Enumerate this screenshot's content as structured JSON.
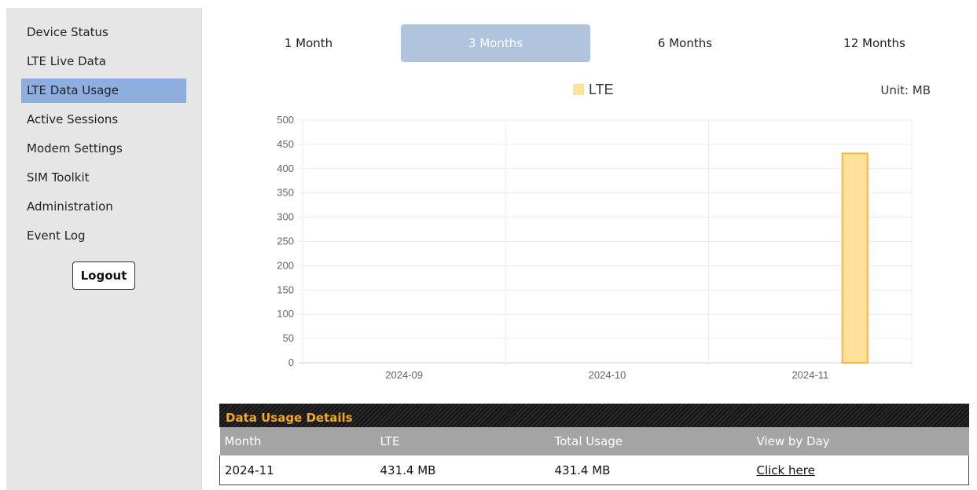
{
  "sidebar": {
    "items": [
      {
        "label": "Device Status"
      },
      {
        "label": "LTE Live Data"
      },
      {
        "label": "LTE Data Usage",
        "active": true
      },
      {
        "label": "Active Sessions"
      },
      {
        "label": "Modem Settings"
      },
      {
        "label": "SIM Toolkit"
      },
      {
        "label": "Administration"
      },
      {
        "label": "Event Log"
      }
    ],
    "logout_label": "Logout"
  },
  "tabs": [
    {
      "label": "1 Month"
    },
    {
      "label": "3 Months",
      "active": true
    },
    {
      "label": "6 Months"
    },
    {
      "label": "12 Months"
    }
  ],
  "unit_label": "Unit: MB",
  "chart_data": {
    "type": "bar",
    "categories": [
      "2024-09",
      "2024-10",
      "2024-11"
    ],
    "series": [
      {
        "name": "LTE",
        "values": [
          0,
          0,
          431.4
        ],
        "color": "#ffe29a",
        "border_color": "#f6b73c"
      }
    ],
    "y_ticks": [
      0,
      50,
      100,
      150,
      200,
      250,
      300,
      350,
      400,
      450,
      500
    ],
    "ylim": [
      0,
      500
    ],
    "grid": true,
    "legend": "top-center"
  },
  "details": {
    "title": "Data Usage Details",
    "columns": [
      "Month",
      "LTE",
      "Total Usage",
      "View by Day"
    ],
    "rows": [
      {
        "month": "2024-11",
        "lte": "431.4 MB",
        "total": "431.4 MB",
        "link": "Click here"
      }
    ]
  },
  "colors": {
    "sidebar_bg": "#e6e6e6",
    "sidebar_active": "#8eaee0",
    "tab_active": "#b0c4de",
    "table_header": "#a4a4a4",
    "table_title": "#f5a623"
  }
}
